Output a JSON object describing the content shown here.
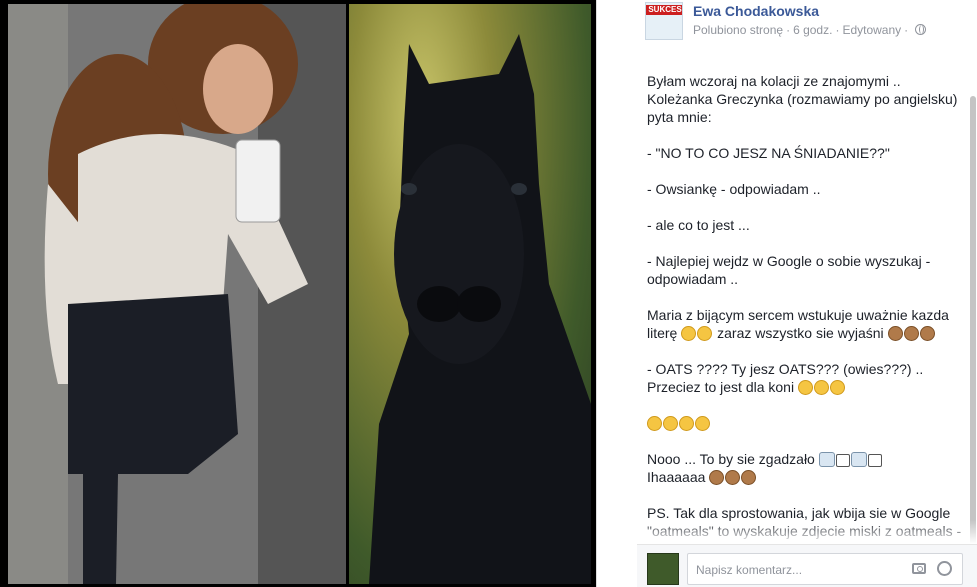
{
  "post": {
    "author": "Ewa Chodakowska",
    "liked": "Polubiono stronę",
    "time": "6 godz.",
    "edited": "Edytowany",
    "avatar_label": "SUKCES",
    "paragraphs": [
      "Byłam wczoraj na kolacji ze znajomymi .. Koleżanka Greczynka (rozmawiamy po angielsku) pyta mnie:",
      "- \"NO TO CO JESZ NA ŚNIADANIE??\"",
      "- Owsiankę - odpowiadam ..",
      "- ale co to jest ...",
      "- Najlepiej wejdz w Google o sobie wyszukaj - odpowiadam ..",
      "Maria z bijącym sercem wstukuje uważnie kazda literę",
      "zaraz wszystko sie wyjaśni",
      "- OATS ???? Ty jesz OATS??? (owies???) .. Przeciez to jest dla koni",
      "Nooo ... To by sie zgadzało",
      "Ihaaaaaa",
      "PS. Tak dla sprostowania, jak wbija sie w Google \"oatmeals\" to wyskakuje zdjecie miski z oatmeals - wciaz niewiele to mówiło zainteresowanej , stąd"
    ]
  },
  "comment": {
    "placeholder": "Napisz komentarz..."
  },
  "icons": {
    "globe": "globe-icon",
    "camera": "camera-icon",
    "emoji": "emoji-icon"
  }
}
